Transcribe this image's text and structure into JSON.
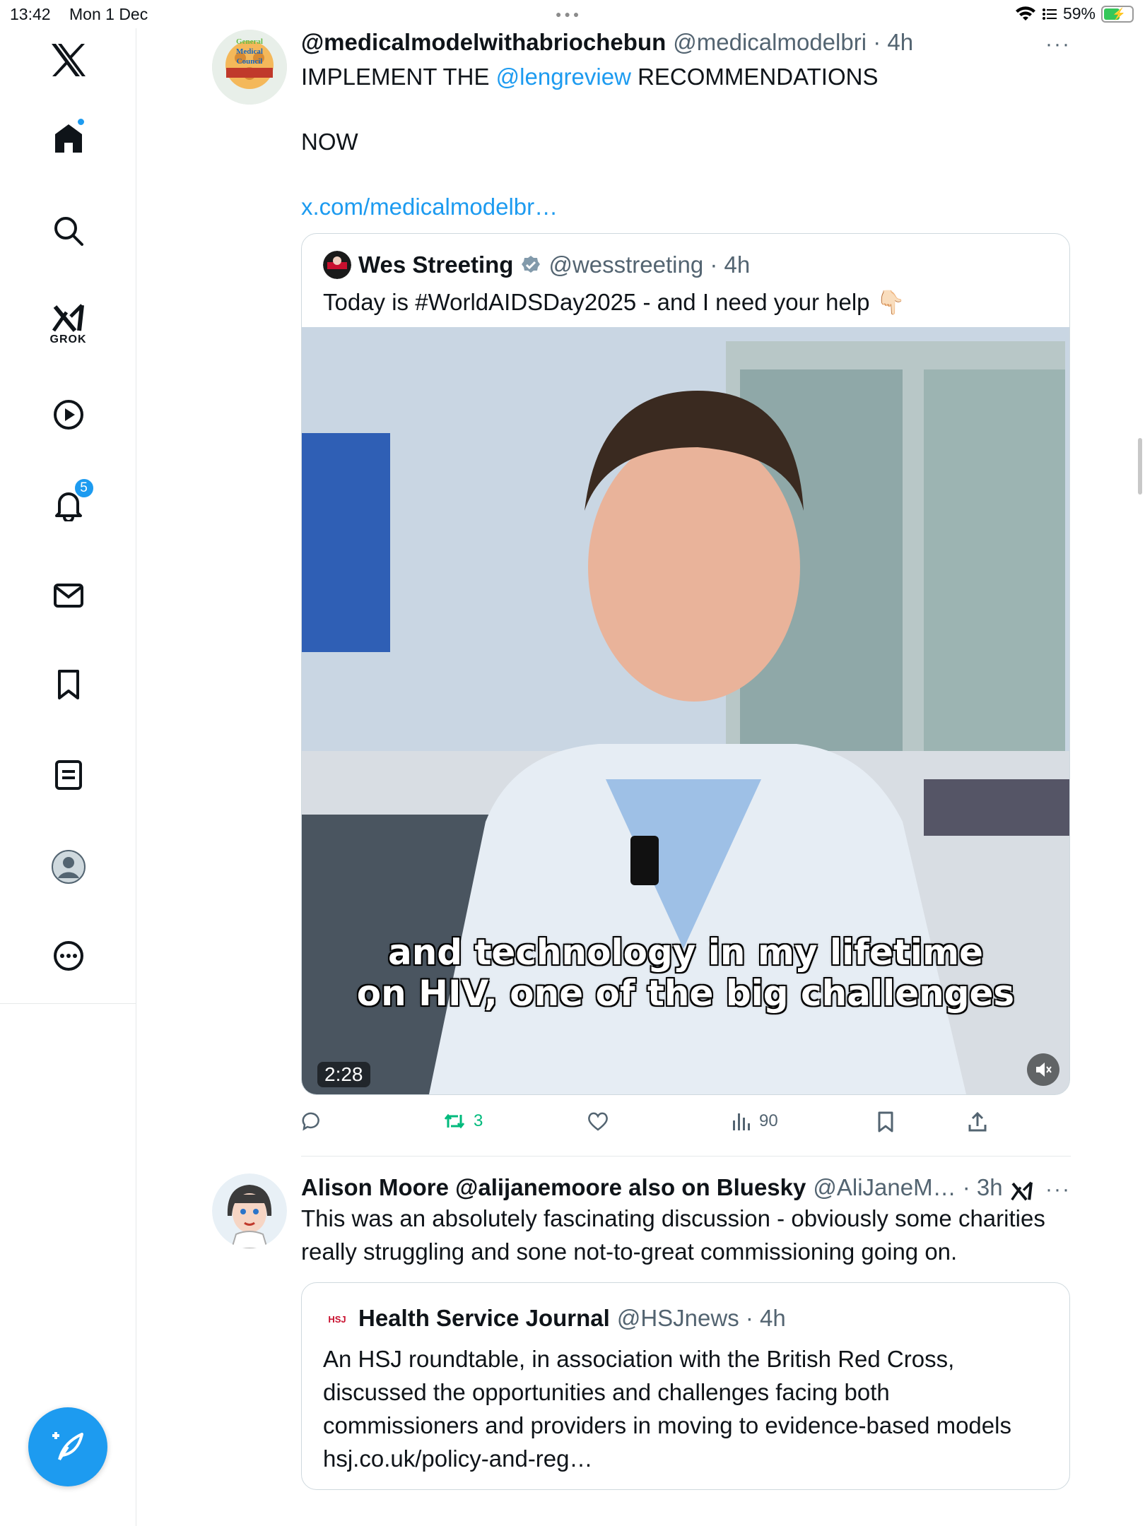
{
  "status_bar": {
    "time": "13:42",
    "date": "Mon 1 Dec",
    "battery": "59%"
  },
  "sidebar": {
    "items": [
      {
        "name": "x-logo-icon"
      },
      {
        "name": "home-icon"
      },
      {
        "name": "search-icon"
      },
      {
        "name": "grok-icon",
        "label": "GROK"
      },
      {
        "name": "video-icon"
      },
      {
        "name": "notifications-icon",
        "badge": "5"
      },
      {
        "name": "messages-icon"
      },
      {
        "name": "bookmarks-icon"
      },
      {
        "name": "lists-icon"
      },
      {
        "name": "profile-icon"
      },
      {
        "name": "more-icon"
      }
    ],
    "accent": "#1d9bf0"
  },
  "tweet1": {
    "name": "@medicalmodelwithabriochebun",
    "handle": "@medicalmodelbri",
    "time": "4h",
    "avatar_text": "General Medical Council",
    "text_line1_prefix": "IMPLEMENT THE ",
    "text_line1_mention": "@lengreview",
    "text_line1_suffix": " RECOMMENDATIONS",
    "text_line2": "NOW",
    "text_link": "x.com/medicalmodelbr…",
    "quote": {
      "name": "Wes Streeting",
      "handle": "@wesstreeting",
      "time": "4h",
      "text": "Today is #WorldAIDSDay2025 - and I need your help 👇🏻",
      "video_caption_line1": "and technology in my lifetime",
      "video_caption_line2": "on HIV, one of the big challenges",
      "video_duration": "2:28"
    },
    "actions": {
      "replies": "",
      "reposts": "3",
      "likes": "",
      "views": "90"
    }
  },
  "tweet2": {
    "name": "Alison Moore @alijanemoore also on Bluesky",
    "handle": "@AliJaneM…",
    "time": "3h",
    "text": "This was an absolutely fascinating discussion - obviously some charities really struggling and sone not-to-great commissioning going on.",
    "quote": {
      "name": "Health Service Journal",
      "handle": "@HSJnews",
      "time": "4h",
      "logo_text": "HSJ",
      "text": "An HSJ roundtable, in association with the British Red Cross, discussed the opportunities and challenges facing both commissioners and providers in moving to evidence-based models",
      "link": "hsj.co.uk/policy-and-reg…"
    }
  }
}
